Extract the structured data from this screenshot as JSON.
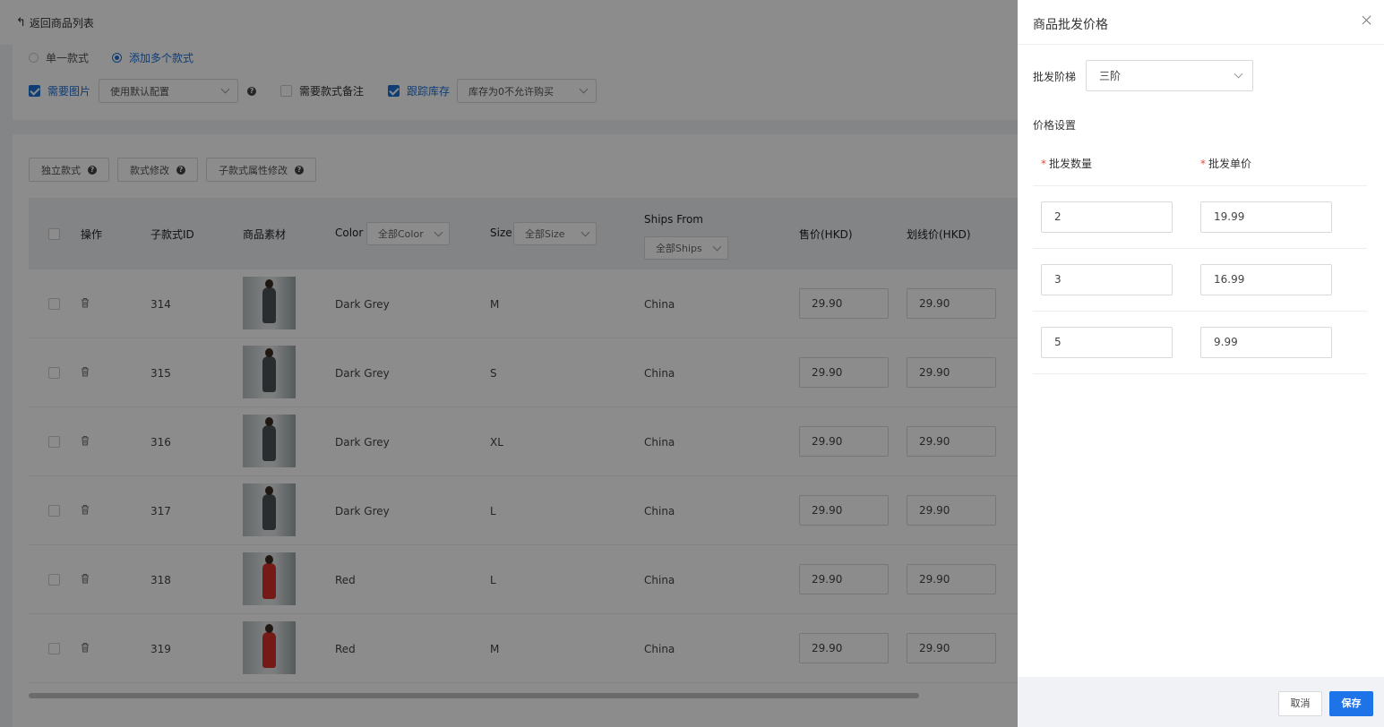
{
  "topbar": {
    "back_label": "返回商品列表"
  },
  "style_config": {
    "radio_single": "单一款式",
    "radio_multi": "添加多个款式",
    "need_image_label": "需要图片",
    "image_config_value": "使用默认配置",
    "need_remark_label": "需要款式备注",
    "track_stock_label": "跟踪库存",
    "stock_policy_value": "库存为0不允许购买"
  },
  "toolbar": {
    "independent_label": "独立款式",
    "style_edit_label": "款式修改",
    "sub_attr_edit_label": "子款式属性修改"
  },
  "table": {
    "headers": {
      "action": "操作",
      "sub_id": "子款式ID",
      "material": "商品素材",
      "color": "Color",
      "color_filter": "全部Color",
      "size": "Size",
      "size_filter": "全部Size",
      "ships_from": "Ships From",
      "ships_filter": "全部Ships",
      "price": "售价(HKD)",
      "strike_price": "划线价(HKD)"
    },
    "rows": [
      {
        "id": "314",
        "color": "Dark Grey",
        "size": "M",
        "ships": "China",
        "price": "29.90",
        "strike": "29.90"
      },
      {
        "id": "315",
        "color": "Dark Grey",
        "size": "S",
        "ships": "China",
        "price": "29.90",
        "strike": "29.90"
      },
      {
        "id": "316",
        "color": "Dark Grey",
        "size": "XL",
        "ships": "China",
        "price": "29.90",
        "strike": "29.90"
      },
      {
        "id": "317",
        "color": "Dark Grey",
        "size": "L",
        "ships": "China",
        "price": "29.90",
        "strike": "29.90"
      },
      {
        "id": "318",
        "color": "Red",
        "size": "L",
        "ships": "China",
        "price": "29.90",
        "strike": "29.90"
      },
      {
        "id": "319",
        "color": "Red",
        "size": "M",
        "ships": "China",
        "price": "29.90",
        "strike": "29.90"
      }
    ]
  },
  "drawer": {
    "title": "商品批发价格",
    "tier_label": "批发阶梯",
    "tier_value": "三阶",
    "section_title": "价格设置",
    "qty_header": "批发数量",
    "unit_price_header": "批发单价",
    "tiers": [
      {
        "qty": "2",
        "price": "19.99"
      },
      {
        "qty": "3",
        "price": "16.99"
      },
      {
        "qty": "5",
        "price": "9.99"
      }
    ],
    "cancel_label": "取消",
    "save_label": "保存"
  },
  "colors": {
    "accent": "#1f73e8",
    "required": "#e34d3d"
  }
}
